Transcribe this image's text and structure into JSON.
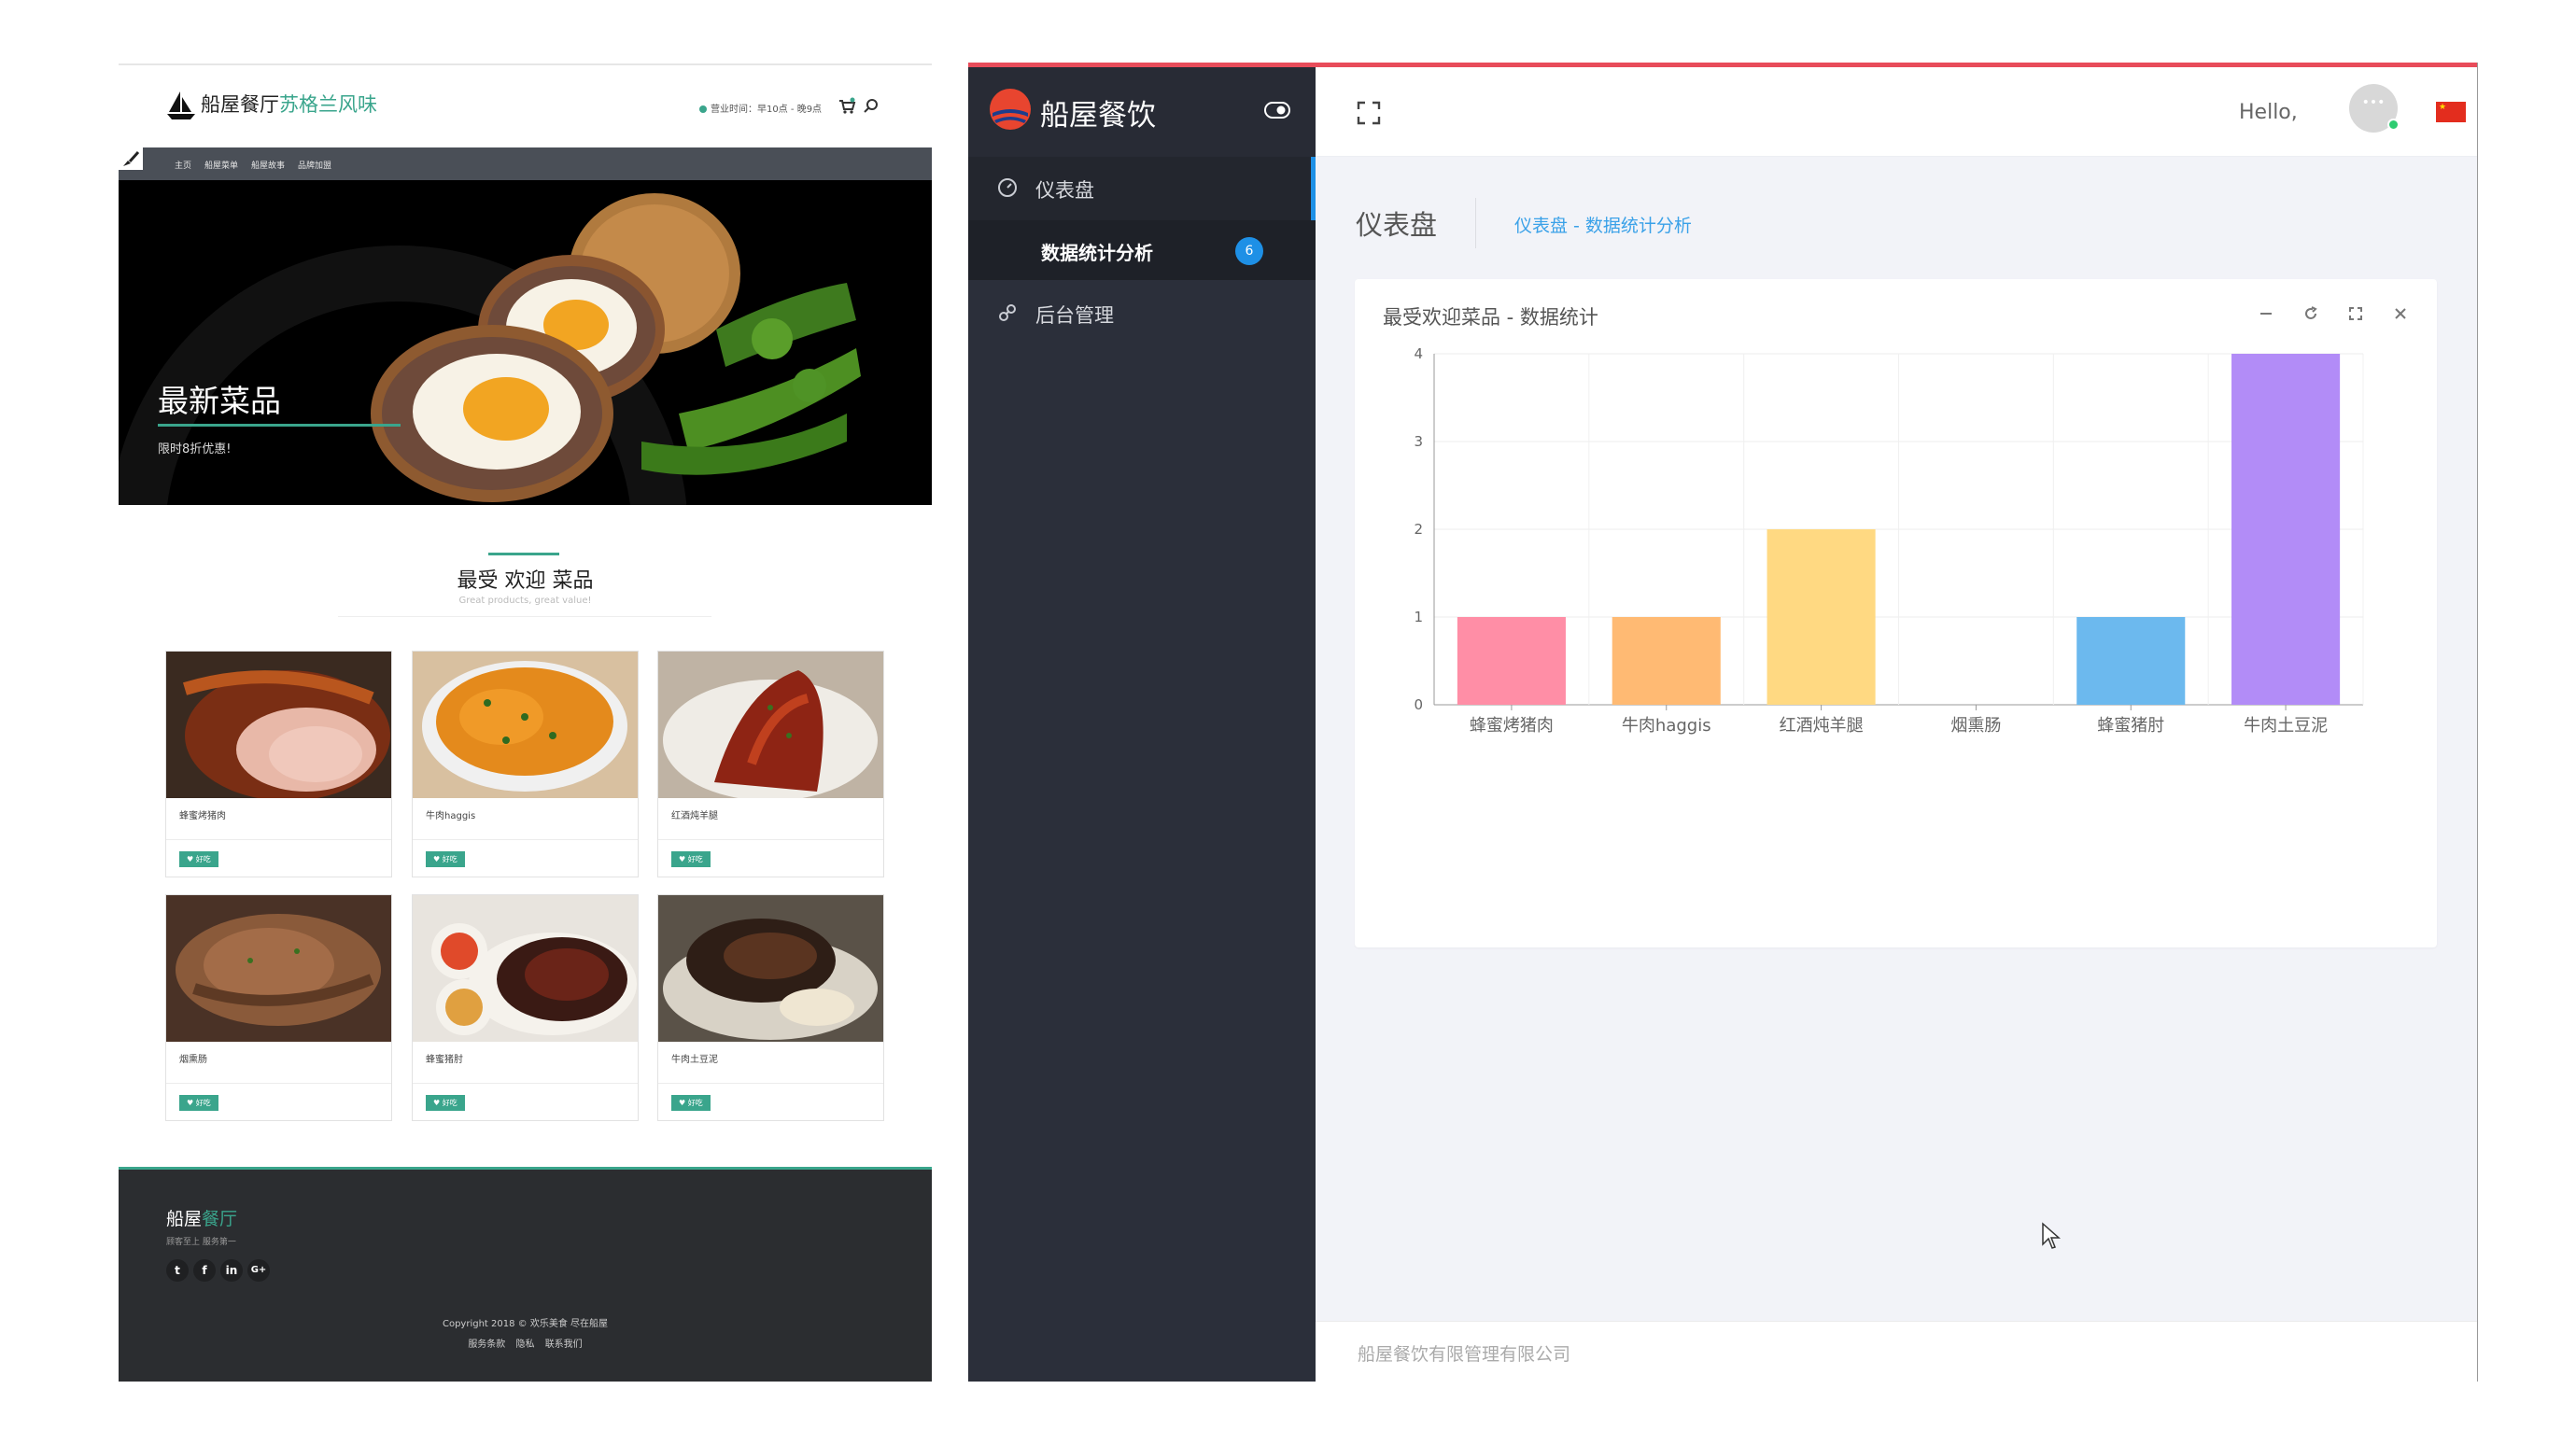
{
  "site": {
    "logo_main": "船屋餐厅",
    "logo_accent": "苏格兰风味",
    "hours": "营业时间：早10点 - 晚9点",
    "nav": [
      "主页",
      "船屋菜单",
      "船屋故事",
      "品牌加盟"
    ],
    "hero": {
      "title": "最新菜品",
      "subtitle": "限时8折优惠!"
    },
    "section": {
      "title": "最受 欢迎 菜品",
      "subtitle": "Great products, great value!"
    },
    "dishes": [
      {
        "name": "蜂蜜烤猪肉",
        "like": "♥ 好吃"
      },
      {
        "name": "牛肉haggis",
        "like": "♥ 好吃"
      },
      {
        "name": "红酒炖羊腿",
        "like": "♥ 好吃"
      },
      {
        "name": "烟熏肠",
        "like": "♥ 好吃"
      },
      {
        "name": "蜂蜜猪肘",
        "like": "♥ 好吃"
      },
      {
        "name": "牛肉土豆泥",
        "like": "♥ 好吃"
      }
    ],
    "footer": {
      "logo_main": "船屋",
      "logo_accent": "餐厅",
      "tagline": "顾客至上 服务第一",
      "social": [
        "twitter-icon",
        "facebook-icon",
        "linkedin-icon",
        "google-plus-icon"
      ],
      "copyright": "Copyright 2018 © 欢乐美食 尽在船屋",
      "links": [
        "服务条款",
        "隐私",
        "联系我们"
      ]
    }
  },
  "admin": {
    "brand": "船屋餐饮",
    "sidebar": {
      "dashboard": "仪表盘",
      "sub_item": "数据统计分析",
      "badge": "6",
      "admin": "后台管理"
    },
    "topbar": {
      "hello": "Hello,",
      "avatar_text": "•••"
    },
    "page_title": "仪表盘",
    "breadcrumb": "仪表盘  -  数据统计分析",
    "panel_title": "最受欢迎菜品 - 数据统计",
    "footer": "船屋餐饮有限管理有限公司"
  },
  "colors": {
    "site_accent": "#3aa58c",
    "admin_accent": "#1e90e6",
    "admin_top_border": "#e84c5a"
  },
  "chart_data": {
    "type": "bar",
    "categories": [
      "蜂蜜烤猪肉",
      "牛肉haggis",
      "红酒炖羊腿",
      "烟熏肠",
      "蜂蜜猪肘",
      "牛肉土豆泥"
    ],
    "values": [
      1,
      1,
      2,
      0,
      1,
      4
    ],
    "colors": [
      "#ff8ea6",
      "#ffba73",
      "#ffd982",
      "#7fd3d3",
      "#6cb9ee",
      "#b28cf7"
    ],
    "ylim": [
      0,
      4
    ],
    "yticks": [
      0,
      1,
      2,
      3,
      4
    ],
    "grid": true
  }
}
